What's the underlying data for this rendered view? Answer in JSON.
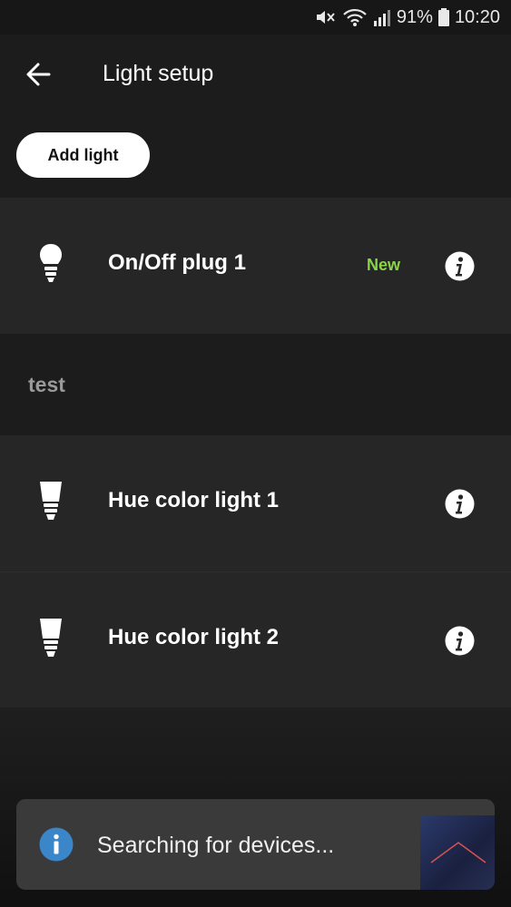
{
  "status_bar": {
    "battery": "91%",
    "time": "10:20"
  },
  "app_bar": {
    "title": "Light setup"
  },
  "actions": {
    "add_light_label": "Add light"
  },
  "lights": [
    {
      "name": "On/Off plug 1",
      "badge": "New",
      "icon": "plug-icon"
    },
    {
      "name": "Hue color light 1",
      "icon": "bulb-icon"
    },
    {
      "name": "Hue color light 2",
      "icon": "bulb-icon"
    }
  ],
  "group": {
    "name": "test"
  },
  "snackbar": {
    "message": "Searching for devices..."
  },
  "colors": {
    "accent_new": "#8ad44b",
    "info_blue": "#3a86c8"
  }
}
